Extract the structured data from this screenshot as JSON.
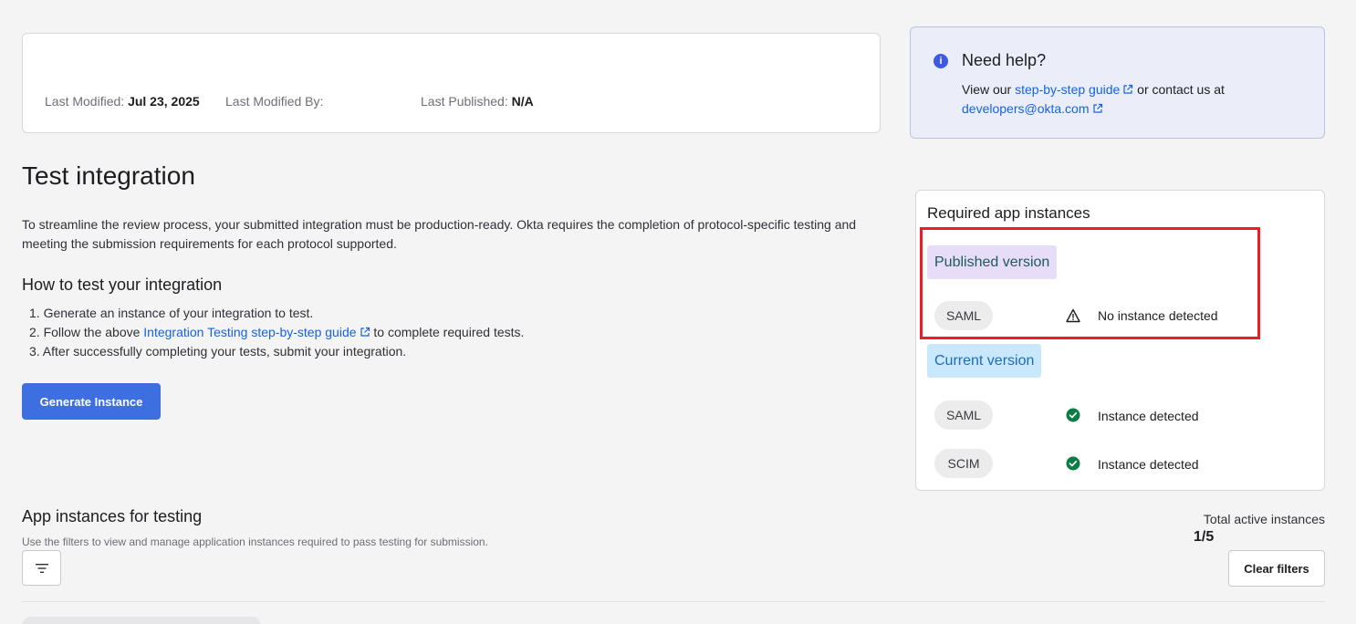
{
  "meta": {
    "last_modified_label": "Last Modified:",
    "last_modified_value": "Jul 23, 2025",
    "last_modified_by_label": "Last Modified By:",
    "last_published_label": "Last Published:",
    "last_published_value": "N/A"
  },
  "help": {
    "title": "Need help?",
    "text_prefix": "View our ",
    "guide_link": "step-by-step guide",
    "text_middle": " or contact us at",
    "email_link": "developers@okta.com"
  },
  "test": {
    "title": "Test integration",
    "intro": "To streamline the review process, your submitted integration must be production-ready. Okta requires the completion of protocol-specific testing and meeting the submission requirements for each protocol supported.",
    "how_title": "How to test your integration",
    "step1": "1. Generate an instance of your integration to test.",
    "step2_prefix": "2. Follow the above ",
    "step2_link": "Integration Testing step-by-step guide",
    "step2_suffix": " to complete required tests.",
    "step3": "3. After successfully completing your tests, submit your integration.",
    "generate_button": "Generate Instance"
  },
  "required": {
    "title": "Required app instances",
    "published_label": "Published version",
    "current_label": "Current version",
    "published_rows": [
      {
        "protocol": "SAML",
        "status": "No instance detected",
        "status_icon": "warning-icon"
      }
    ],
    "current_rows": [
      {
        "protocol": "SAML",
        "status": "Instance detected",
        "status_icon": "check-circle-icon"
      },
      {
        "protocol": "SCIM",
        "status": "Instance detected",
        "status_icon": "check-circle-icon"
      }
    ]
  },
  "instances": {
    "title": "App instances for testing",
    "subtitle": "Use the filters to view and manage application instances required to pass testing for submission.",
    "total_label": "Total active instances",
    "total_value": "1/5",
    "clear_button": "Clear filters"
  },
  "colors": {
    "primary": "#3d6fe0",
    "link": "#1662dd",
    "success": "#0a7d47",
    "highlight": "#ee1d23"
  }
}
